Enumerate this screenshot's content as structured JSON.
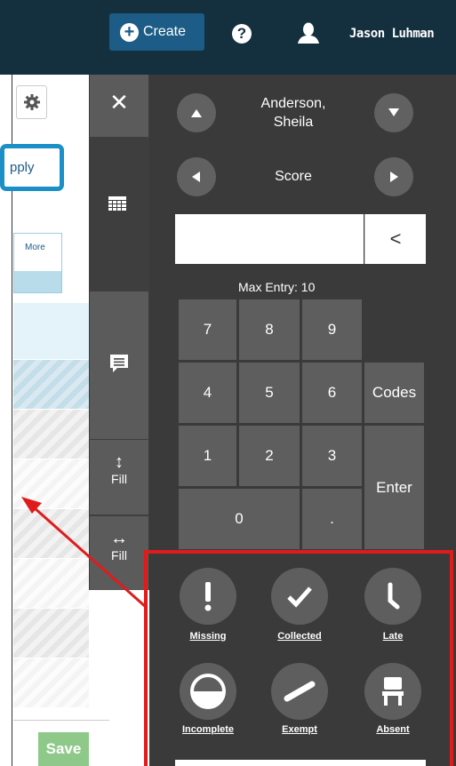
{
  "header": {
    "create_label": "Create",
    "user_name": "Jason Luhman",
    "icons": [
      "plus-circle-icon",
      "help-icon",
      "user-icon"
    ]
  },
  "background": {
    "apply_label": "pply",
    "more_label": "More",
    "save_label": "Save"
  },
  "side_tools": {
    "close_glyph": "✕",
    "fill_vertical_label": "Fill",
    "fill_horizontal_label": "Fill",
    "fill_vertical_glyph": "↕",
    "fill_horizontal_glyph": "↔"
  },
  "keypad": {
    "student_name_line1": "Anderson,",
    "student_name_line2": "Sheila",
    "column_label": "Score",
    "entry_value": "",
    "backspace_glyph": "<",
    "max_entry": "Max Entry: 10",
    "keys": {
      "k7": "7",
      "k8": "8",
      "k9": "9",
      "k4": "4",
      "k5": "5",
      "k6": "6",
      "k1": "1",
      "k2": "2",
      "k3": "3",
      "k0": "0",
      "dot": ".",
      "codes": "Codes",
      "enter": "Enter"
    }
  },
  "statuses": {
    "missing": "Missing",
    "collected": "Collected",
    "late": "Late",
    "incomplete": "Incomplete",
    "exempt": "Exempt",
    "absent": "Absent"
  },
  "colors": {
    "topbar": "#14303f",
    "create_button": "#1d5c86",
    "panel": "#3a3a3a",
    "key": "#5e5e5e",
    "highlight": "#e01b1b",
    "save_button": "#8ec98a"
  }
}
